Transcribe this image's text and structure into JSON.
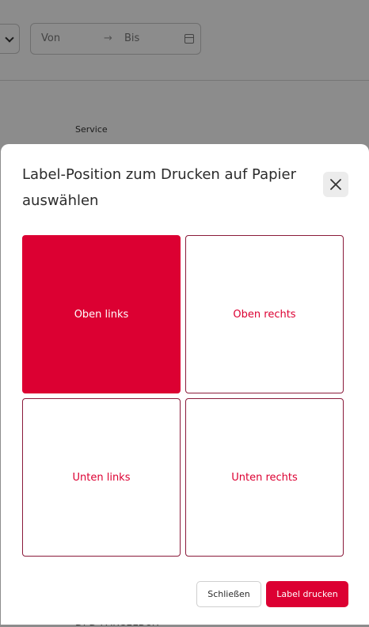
{
  "background": {
    "date_from_placeholder": "Von",
    "date_arrow": "→",
    "date_to_placeholder": "Bis",
    "column_header": "Service",
    "bottom_text": "DPD PARCELBOX"
  },
  "modal": {
    "title": "Label-Position zum Drucken auf Papier auswählen",
    "positions": [
      {
        "label": "Oben links",
        "selected": true
      },
      {
        "label": "Oben rechts",
        "selected": false
      },
      {
        "label": "Unten links",
        "selected": false
      },
      {
        "label": "Unten rechts",
        "selected": false
      }
    ],
    "close_label": "Schließen",
    "print_label": "Label drucken"
  },
  "colors": {
    "accent": "#dc0032",
    "border": "#8a1a3a",
    "overlay": "rgba(0,0,0,0.45)"
  },
  "icons": {
    "close": "close-icon",
    "calendar": "calendar-icon",
    "dropdown": "chevron-down-icon"
  }
}
